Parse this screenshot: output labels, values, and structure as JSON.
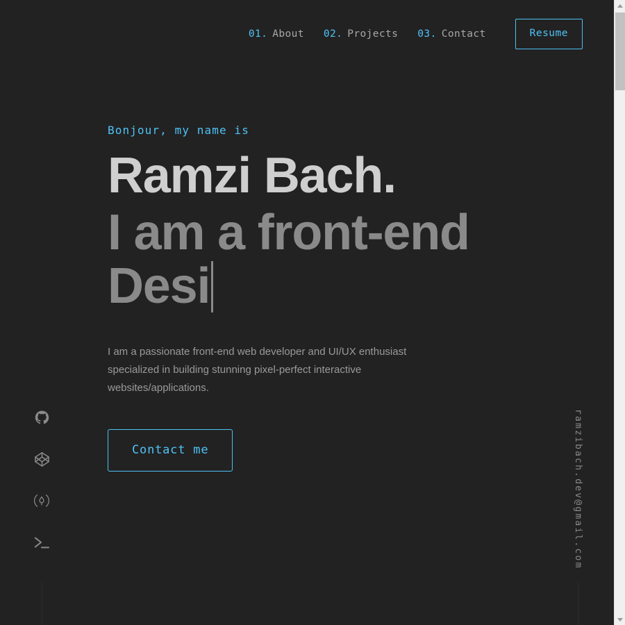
{
  "page": {
    "background_color": "#222222",
    "accent_color": "#4fc3f7",
    "heading_color": "#cfcfcf",
    "muted_color": "#8a8a8a"
  },
  "header": {
    "nav": [
      {
        "num": "01.",
        "label": "About",
        "name": "nav-item-about"
      },
      {
        "num": "02.",
        "label": "Projects",
        "name": "nav-item-projects"
      },
      {
        "num": "03.",
        "label": "Contact",
        "name": "nav-item-contact"
      }
    ],
    "resume_label": "Resume"
  },
  "hero": {
    "greeting": "Bonjour, my name is",
    "name": "Ramzi Bach.",
    "tagline": "I am a front-end Desi",
    "description": "I am a passionate front-end web developer and UI/UX enthusiast specialized in building stunning pixel-perfect interactive websites/applications.",
    "cta_label": "Contact me"
  },
  "social": {
    "items": [
      {
        "icon": "github-icon",
        "label": "GitHub"
      },
      {
        "icon": "codepen-icon",
        "label": "CodePen"
      },
      {
        "icon": "frontend-mentor-icon",
        "label": "Frontend Mentor"
      },
      {
        "icon": "terminal-icon",
        "label": "Terminal"
      }
    ]
  },
  "email": {
    "address": "ramzibach.dev@gmail.com"
  },
  "scrollbar": {
    "thumb_color": "#c1c1c1",
    "track_color": "#f0f0f0",
    "position_percent": 2
  }
}
